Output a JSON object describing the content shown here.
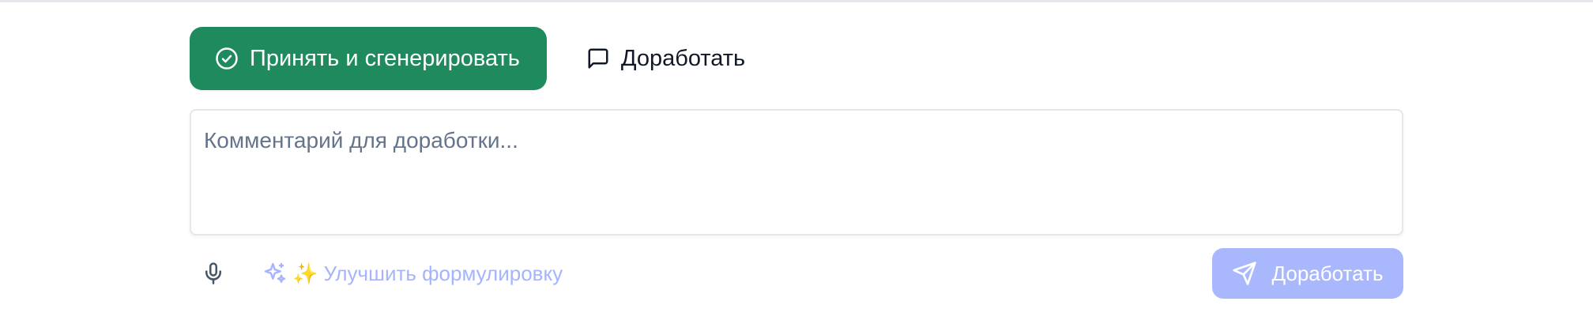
{
  "actions": {
    "accept_label": "Принять и сгенерировать",
    "refine_label": "Доработать"
  },
  "comment": {
    "placeholder": "Комментарий для доработки...",
    "value": ""
  },
  "toolbar": {
    "improve_label": "✨ Улучшить формулировку",
    "submit_label": "Доработать"
  },
  "colors": {
    "accept_bg": "#1e8a5e",
    "submit_bg": "#a5b4fc",
    "improve_text": "#a5b4fc",
    "placeholder": "#64748b"
  },
  "icons": {
    "accept": "check-circle-icon",
    "refine": "message-square-icon",
    "mic": "microphone-icon",
    "improve": "sparkles-icon",
    "submit": "send-icon"
  }
}
